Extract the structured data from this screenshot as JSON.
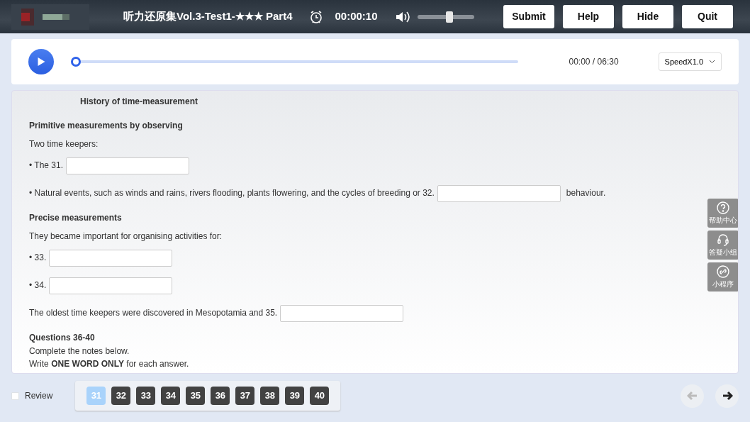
{
  "header": {
    "title": "听力还原集Vol.3-Test1-★★★ Part4",
    "timer": "00:00:10",
    "volume": {
      "level": 0.57
    },
    "buttons": [
      "Submit",
      "Help",
      "Hide",
      "Quit"
    ]
  },
  "player": {
    "playing": false,
    "progress": {
      "level": 0
    },
    "time": "00:00 / 06:30",
    "speed": "SpeedX1.0"
  },
  "content": [
    {
      "kind": "title",
      "text": "History of time-measurement"
    },
    {
      "kind": "heading",
      "text": "Primitive measurements by observing"
    },
    {
      "kind": "text",
      "text": "Two time keepers:"
    },
    {
      "kind": "blank",
      "before": "• The 31."
    },
    {
      "kind": "blank",
      "before": "• Natural events, such as winds and rains, rivers flooding, plants flowering, and the cycles of breeding or 32.",
      "after": "behaviour."
    },
    {
      "kind": "heading",
      "text": "Precise measurements"
    },
    {
      "kind": "text",
      "text": "They became important for organising activities for:"
    },
    {
      "kind": "blank",
      "before": "• 33."
    },
    {
      "kind": "blank",
      "before": "• 34."
    },
    {
      "kind": "blank",
      "before": "The oldest time keepers were discovered in Mesopotamia and 35."
    },
    {
      "kind": "subheading",
      "text": "Questions 36-40"
    },
    {
      "kind": "line",
      "text": "Complete the notes below."
    },
    {
      "kind": "line",
      "text": "Write **ONE WORD ONLY** for each answer."
    }
  ],
  "side_tools": [
    {
      "kind": "help",
      "label": "帮助中心"
    },
    {
      "kind": "headset",
      "label": "答疑小组"
    },
    {
      "kind": "link",
      "label": "小程序"
    }
  ],
  "review": {
    "label": "Review",
    "checked": false
  },
  "questions": [
    {
      "number": "31",
      "selected": true
    },
    {
      "number": "32",
      "selected": false
    },
    {
      "number": "33",
      "selected": false
    },
    {
      "number": "34",
      "selected": false
    },
    {
      "number": "35",
      "selected": false
    },
    {
      "number": "36",
      "selected": false
    },
    {
      "number": "37",
      "selected": false
    },
    {
      "number": "38",
      "selected": false
    },
    {
      "number": "39",
      "selected": false
    },
    {
      "number": "40",
      "selected": false
    }
  ],
  "nav": {
    "previous": {
      "disabled": true
    },
    "next": {
      "disabled": false
    }
  }
}
